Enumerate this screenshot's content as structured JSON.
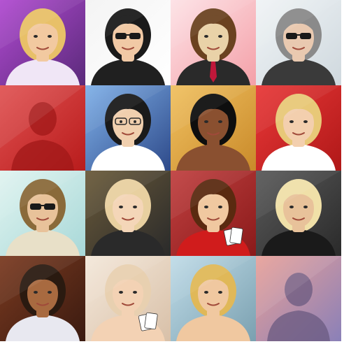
{
  "avatars": [
    {
      "id": "a01",
      "kind": "portrait",
      "icon": "woman-blonde-waving-icon",
      "bg": "#5a2a7a",
      "bg2": "#b04ad0",
      "skin": "#f2c9a0",
      "hair": "#e8c068",
      "shirt": "#f0e6f6",
      "accessory": "none"
    },
    {
      "id": "a02",
      "kind": "portrait",
      "icon": "man-sunglasses-suit-icon",
      "bg": "#ffffff",
      "bg2": "#f4f4f4",
      "skin": "#f1c9a5",
      "hair": "#1a1a1a",
      "shirt": "#202020",
      "accessory": "sunglasses"
    },
    {
      "id": "a03",
      "kind": "portrait",
      "icon": "man-red-tie-icon",
      "bg": "#f4a0a8",
      "bg2": "#fde2e6",
      "skin": "#e9d2a8",
      "hair": "#6b4220",
      "shirt": "#2a2a2a",
      "accessory": "tie"
    },
    {
      "id": "a04",
      "kind": "portrait",
      "icon": "man-beanie-sunglasses-icon",
      "bg": "#cfd8de",
      "bg2": "#f0f4f6",
      "skin": "#e9c9b0",
      "hair": "#8a8a8a",
      "shirt": "#3a3a3a",
      "accessory": "sunglasses"
    },
    {
      "id": "a05",
      "kind": "silhouette",
      "icon": "female-silhouette-placeholder-icon",
      "bg": "#b81c1c",
      "bg2": "#e05050",
      "skin": "#a01818",
      "hair": "#a01818",
      "shirt": "#a01818",
      "accessory": "none"
    },
    {
      "id": "a06",
      "kind": "portrait",
      "icon": "woman-short-hair-glasses-icon",
      "bg": "#2e4a8a",
      "bg2": "#7fb0e8",
      "skin": "#f0cfae",
      "hair": "#1a1a1a",
      "shirt": "#ffffff",
      "accessory": "glasses"
    },
    {
      "id": "a07",
      "kind": "portrait",
      "icon": "woman-afro-hair-icon",
      "bg": "#c98a2a",
      "bg2": "#f0c060",
      "skin": "#8a5030",
      "hair": "#0e0e0e",
      "shirt": "#8a5030",
      "accessory": "none"
    },
    {
      "id": "a08",
      "kind": "portrait",
      "icon": "woman-curly-blonde-red-icon",
      "bg": "#b01818",
      "bg2": "#e83838",
      "skin": "#f3cfae",
      "hair": "#e8c878",
      "shirt": "#ffffff",
      "accessory": "none"
    },
    {
      "id": "a09",
      "kind": "portrait",
      "icon": "man-aviator-sunglasses-icon",
      "bg": "#a8d8d8",
      "bg2": "#e0f4f0",
      "skin": "#e8c29a",
      "hair": "#8a6a3a",
      "shirt": "#e8e0c8",
      "accessory": "sunglasses"
    },
    {
      "id": "a10",
      "kind": "portrait",
      "icon": "woman-blonde-bob-icon",
      "bg": "#2a2a2a",
      "bg2": "#6a5a3a",
      "skin": "#f4d6b8",
      "hair": "#e8d0a0",
      "shirt": "#2a2a2a",
      "accessory": "none"
    },
    {
      "id": "a11",
      "kind": "portrait",
      "icon": "woman-red-dress-cards-icon",
      "bg": "#8a1a1a",
      "bg2": "#c04040",
      "skin": "#f0c8a0",
      "hair": "#5a2a10",
      "shirt": "#d01c1c",
      "accessory": "cards"
    },
    {
      "id": "a12",
      "kind": "portrait",
      "icon": "man-blonde-spiky-hair-icon",
      "bg": "#2a2a2a",
      "bg2": "#5a5a5a",
      "skin": "#e8c29a",
      "hair": "#f0e0a8",
      "shirt": "#1a1a1a",
      "accessory": "none"
    },
    {
      "id": "a13",
      "kind": "portrait",
      "icon": "man-dark-hair-open-shirt-icon",
      "bg": "#3a1a10",
      "bg2": "#7a3a20",
      "skin": "#a86a40",
      "hair": "#2a1a10",
      "shirt": "#e8e8f0",
      "accessory": "none"
    },
    {
      "id": "a14",
      "kind": "portrait",
      "icon": "woman-blonde-cards-icon",
      "bg": "#d8c0a8",
      "bg2": "#f4e8da",
      "skin": "#f3d2b4",
      "hair": "#e8d0b0",
      "shirt": "#f3d2b4",
      "accessory": "cards"
    },
    {
      "id": "a15",
      "kind": "portrait",
      "icon": "woman-blonde-long-hair-icon",
      "bg": "#7aa0b0",
      "bg2": "#c0dce8",
      "skin": "#f0c8a0",
      "hair": "#e0b858",
      "shirt": "#f0c8a0",
      "accessory": "none"
    },
    {
      "id": "a16",
      "kind": "silhouette",
      "icon": "male-silhouette-placeholder-icon",
      "bg": "#8a80b8",
      "bg2": "#e8a098",
      "skin": "#6a5a80",
      "hair": "#6a5a80",
      "shirt": "#6a5a80",
      "accessory": "none"
    }
  ]
}
